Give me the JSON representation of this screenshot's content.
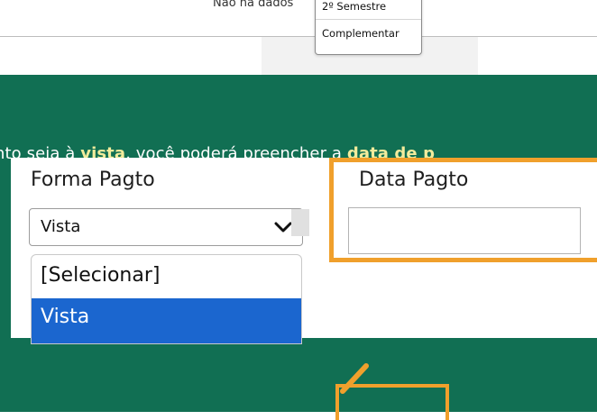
{
  "table": {
    "empty_text": "Não há dados",
    "semester_options": [
      "2º Semestre",
      "Complementar"
    ]
  },
  "banner": {
    "text_before_1": "nto seja à ",
    "bold_1": "vista",
    "text_middle": ", você poderá preencher a ",
    "bold_2": "data de p"
  },
  "form": {
    "payment_label": "Forma Pagto",
    "payment_selected": "Vista",
    "payment_options": [
      "[Selecionar]",
      "Vista"
    ],
    "date_label": "Data Pagto",
    "date_value": ""
  },
  "colors": {
    "banner_green": "#116f53",
    "highlight_yellow": "#f3ec9c",
    "callout_orange": "#f0a02c",
    "selection_blue": "#1b66cf"
  }
}
